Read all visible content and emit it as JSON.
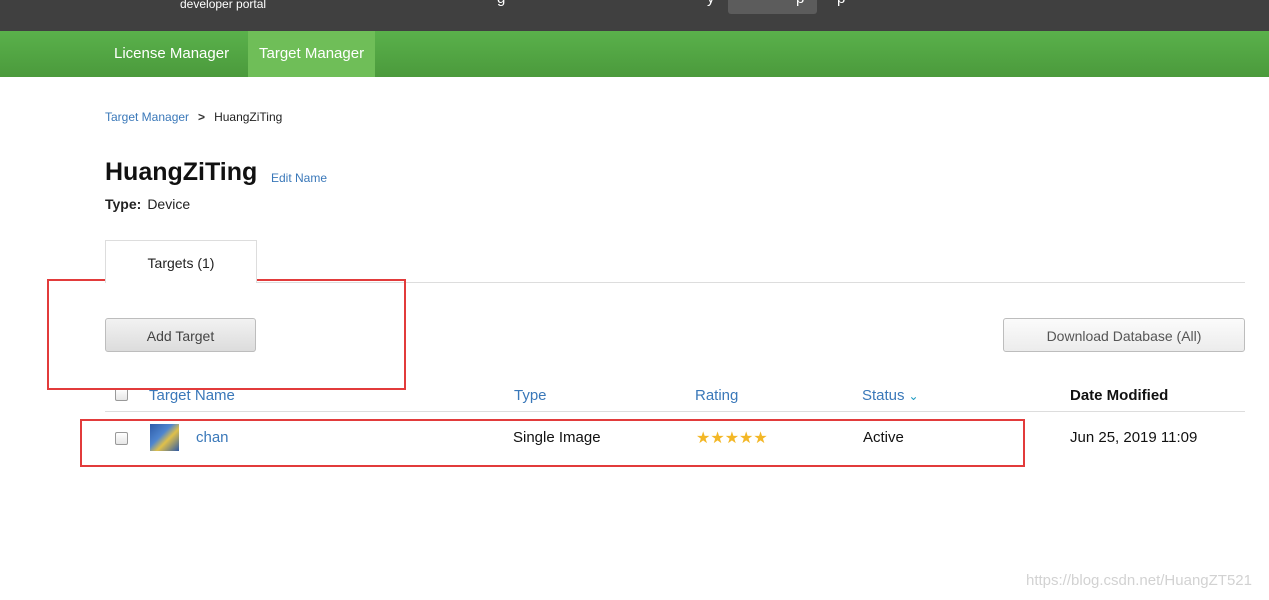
{
  "topbar": {
    "portal_label": "developer portal"
  },
  "nav": {
    "items": [
      {
        "label": "License Manager",
        "active": false
      },
      {
        "label": "Target Manager",
        "active": true
      }
    ]
  },
  "breadcrumb": {
    "root": "Target Manager",
    "separator": ">",
    "current": "HuangZiTing"
  },
  "database": {
    "name": "HuangZiTing",
    "edit_label": "Edit Name",
    "type_label": "Type:",
    "type_value": "Device"
  },
  "tabs": [
    {
      "label": "Targets (1)",
      "active": true
    }
  ],
  "actions": {
    "add_label": "Add Target",
    "download_label": "Download Database (All)"
  },
  "table": {
    "columns": [
      {
        "key": "name",
        "label": "Target Name"
      },
      {
        "key": "type",
        "label": "Type"
      },
      {
        "key": "rating",
        "label": "Rating"
      },
      {
        "key": "status",
        "label": "Status",
        "sorted": "desc"
      },
      {
        "key": "date",
        "label": "Date Modified"
      }
    ],
    "rows": [
      {
        "name": "chan",
        "type": "Single Image",
        "rating": 5,
        "rating_stars": "★★★★★",
        "status": "Active",
        "date": "Jun 25, 2019 11:09"
      }
    ]
  },
  "watermark": "https://blog.csdn.net/HuangZT521",
  "colors": {
    "nav_green": "#4fa640",
    "link_blue": "#3a78b9",
    "highlight_red": "#e23b3b",
    "star_gold": "#f3b726"
  }
}
